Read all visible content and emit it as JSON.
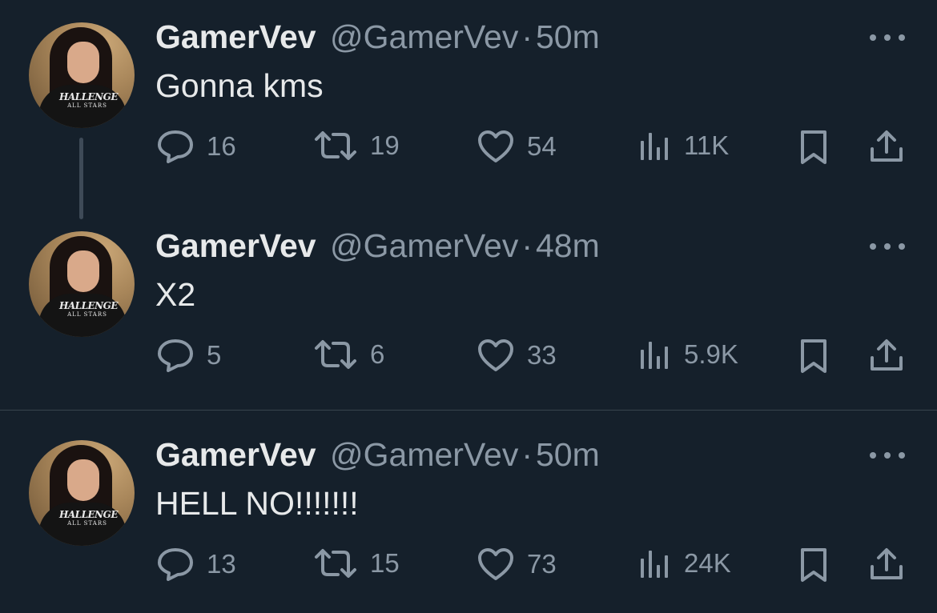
{
  "colors": {
    "background": "#15202b",
    "primary_text": "#e7e9ea",
    "secondary_text": "#8b98a5",
    "thread_line": "#3e4a57",
    "divider": "#38444d"
  },
  "avatar": {
    "shirt_text": "HALLENGE",
    "shirt_subtext": "ALL STARS"
  },
  "tweets": [
    {
      "name": "GamerVev",
      "handle": "@GamerVev",
      "separator": "·",
      "time": "50m",
      "text": "Gonna kms",
      "replies": "16",
      "reposts": "19",
      "likes": "54",
      "views": "11K"
    },
    {
      "name": "GamerVev",
      "handle": "@GamerVev",
      "separator": "·",
      "time": "48m",
      "text": "X2",
      "replies": "5",
      "reposts": "6",
      "likes": "33",
      "views": "5.9K"
    },
    {
      "name": "GamerVev",
      "handle": "@GamerVev",
      "separator": "·",
      "time": "50m",
      "text": "HELL NO!!!!!!!",
      "replies": "13",
      "reposts": "15",
      "likes": "73",
      "views": "24K"
    }
  ],
  "icons": [
    "reply-icon",
    "repost-icon",
    "like-icon",
    "views-icon",
    "bookmark-icon",
    "share-icon",
    "more-icon"
  ]
}
